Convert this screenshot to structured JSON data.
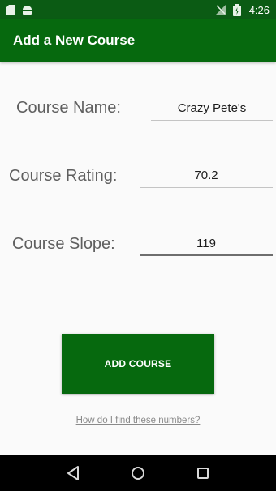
{
  "status_bar": {
    "time": "4:26",
    "icons": [
      "sd-card-icon",
      "android-icon",
      "no-signal-icon",
      "battery-icon"
    ]
  },
  "app_bar": {
    "title": "Add a New Course"
  },
  "form": {
    "course_name": {
      "label": "Course Name:",
      "value": "Crazy Pete's"
    },
    "course_rating": {
      "label": "Course Rating:",
      "value": "70.2"
    },
    "course_slope": {
      "label": "Course Slope:",
      "value": "119"
    }
  },
  "actions": {
    "add_course_label": "ADD COURSE",
    "help_link": "How do I find these numbers?"
  },
  "nav_bar": {
    "icons": [
      "back-icon",
      "home-icon",
      "recents-icon"
    ]
  },
  "colors": {
    "primary": "#06690e",
    "status_bar": "#0b5b14",
    "background": "#fafafa",
    "label_text": "#5f5f5f"
  }
}
